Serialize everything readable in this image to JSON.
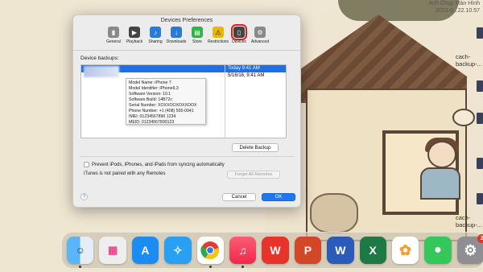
{
  "menubar": {
    "name_text": "Anh Chụp Màn Hình",
    "time_text": "2023-0...22.10.57"
  },
  "desktop_files": [
    "cach-backup-...",
    "cach-backup-...",
    "cach-backup-..."
  ],
  "dialog": {
    "title": "Devices Preferences",
    "toolbar": [
      {
        "label": "General",
        "icon": "switch-icon",
        "color": "#8a8a8a"
      },
      {
        "label": "Playback",
        "icon": "play-icon",
        "color": "#444444"
      },
      {
        "label": "Sharing",
        "icon": "music-note-icon",
        "color": "#2b7bd6"
      },
      {
        "label": "Downloads",
        "icon": "download-arrow-icon",
        "color": "#2b7bd6"
      },
      {
        "label": "Store",
        "icon": "store-icon",
        "color": "#31b34a"
      },
      {
        "label": "Restrictions",
        "icon": "restrictions-icon",
        "color": "#e6b800"
      },
      {
        "label": "Devices",
        "icon": "iphone-icon",
        "color": "#444444"
      },
      {
        "label": "Advanced",
        "icon": "gear-icon",
        "color": "#8a8a8a"
      }
    ],
    "active_tab": "Devices",
    "backups_label": "Device backups:",
    "backups": [
      {
        "name": "",
        "date": "Today 9:41 AM",
        "selected": true
      },
      {
        "name": "",
        "date": "5/16/16, 9:41 AM",
        "selected": false
      }
    ],
    "tooltip_lines": [
      "Model Name: iPhone 7",
      "Model Identifier: iPhone9,3",
      "Software Version: 10.1",
      "Software Build: 14B72c",
      "Serial Number: XOXXOOXOXXOOX",
      "Phone Number: +1 (408) 555-0941",
      "IMEI: 01234567890 1234",
      "MEID: 01234567890123"
    ],
    "delete_button": "Delete Backup",
    "prevent_label": "Prevent iPods, iPhones, and iPads from syncing automatically",
    "remotes_text": "iTunes is not paired with any Remotes",
    "forget_button": "Forget All Remotes",
    "help_button": "?",
    "cancel_button": "Cancel",
    "ok_button": "OK"
  },
  "dock": [
    {
      "name": "finder",
      "glyph": "",
      "color": "#3a9cf0",
      "running": true
    },
    {
      "name": "launchpad",
      "glyph": "",
      "color": "#e8e8e8",
      "running": false
    },
    {
      "name": "app-store",
      "glyph": "A",
      "color": "#1b8cf2",
      "running": false
    },
    {
      "name": "safari",
      "glyph": "",
      "color": "#2aa0f5",
      "running": false
    },
    {
      "name": "chrome",
      "glyph": "",
      "color": "#ffffff",
      "running": true
    },
    {
      "name": "music",
      "glyph": "♫",
      "color": "#f5344d",
      "running": true
    },
    {
      "name": "wps",
      "glyph": "W",
      "color": "#e8332a",
      "running": false
    },
    {
      "name": "powerpoint",
      "glyph": "P",
      "color": "#d24726",
      "running": false
    },
    {
      "name": "word",
      "glyph": "W",
      "color": "#2b5bb8",
      "running": false
    },
    {
      "name": "excel",
      "glyph": "X",
      "color": "#1d7a44",
      "running": false
    },
    {
      "name": "photos",
      "glyph": "",
      "color": "#ffffff",
      "running": false
    },
    {
      "name": "messages",
      "glyph": "",
      "color": "#34c759",
      "running": false
    },
    {
      "name": "system-settings",
      "glyph": "",
      "color": "#8e8e93",
      "running": false,
      "badge": "2"
    }
  ]
}
